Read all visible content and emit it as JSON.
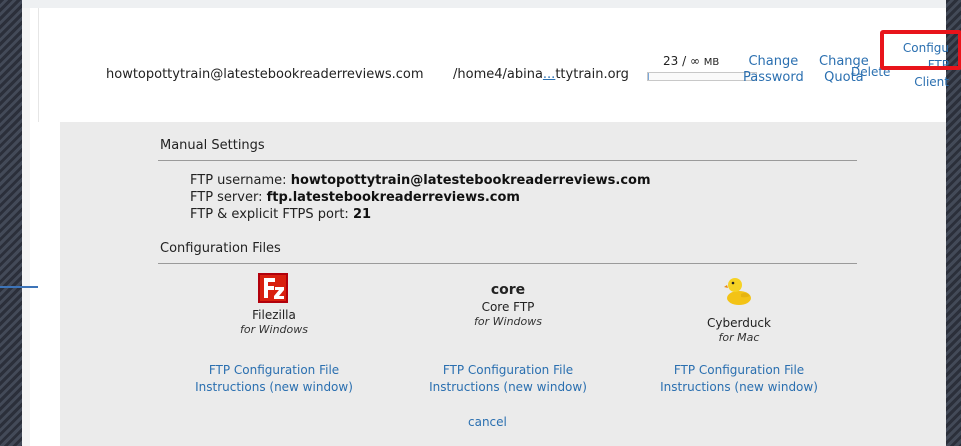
{
  "account": {
    "email": "howtopottytrain@latestebookreaderreviews.com",
    "directory_start": "/home4/abina",
    "directory_ellipsis": "...",
    "directory_end": "ttytrain.org",
    "quota_used": "23 / ∞",
    "quota_unit": "MB",
    "quota_fill_fraction": 0.01,
    "change_password_line1": "Change",
    "change_password_line2": "Password",
    "change_quota_line1": "Change",
    "change_quota_line2": "Quota",
    "delete_label": "Delete",
    "configure_line1": "Configu",
    "configure_line2": "FTP",
    "configure_line3": "Client"
  },
  "manual_settings": {
    "title": "Manual Settings",
    "username_label": "FTP username:",
    "username_value": "howtopottytrain@latestebookreaderreviews.com",
    "server_label": "FTP server:",
    "server_value": "ftp.latestebookreaderreviews.com",
    "port_label": "FTP & explicit FTPS port:",
    "port_value": "21"
  },
  "config_files": {
    "title": "Configuration Files",
    "clients": [
      {
        "name": "Filezilla",
        "platform": "for Windows",
        "icon": "filezilla-icon",
        "link_line1": "FTP Configuration File",
        "link_line2": "Instructions (new window)"
      },
      {
        "name": "Core FTP",
        "platform": "for Windows",
        "icon": "coreftp-icon",
        "icon_text": "core",
        "link_line1": "FTP Configuration File",
        "link_line2": "Instructions (new window)"
      },
      {
        "name": "Cyberduck",
        "platform": "for Mac",
        "icon": "cyberduck-icon",
        "link_line1": "FTP Configuration File",
        "link_line2": "Instructions (new window)"
      }
    ],
    "cancel_label": "cancel"
  },
  "colors": {
    "link": "#2a6fb0",
    "highlight": "#e8141b",
    "panel": "#ebebeb"
  }
}
